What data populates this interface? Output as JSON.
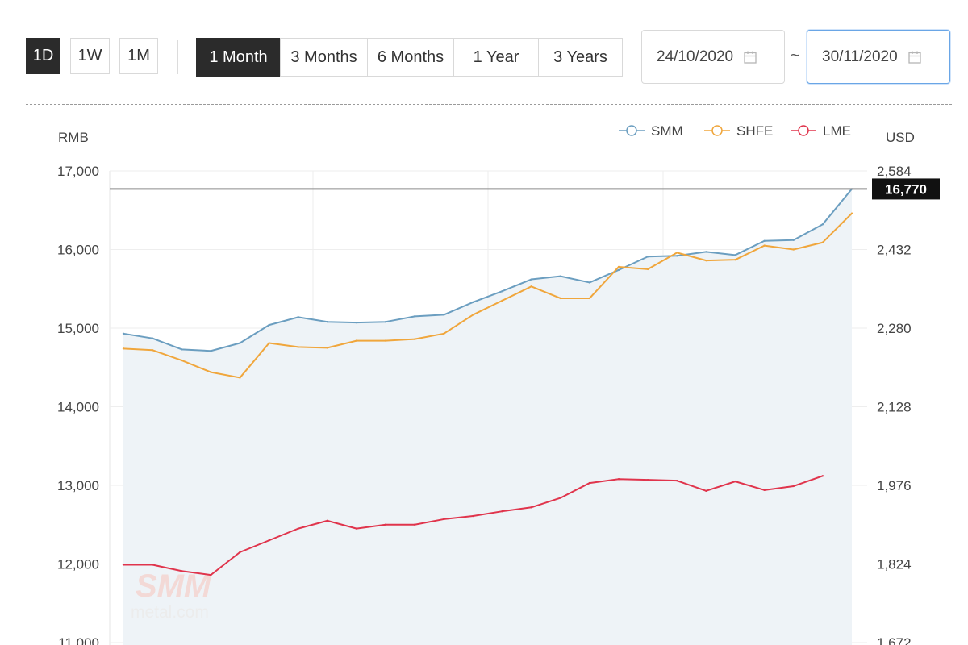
{
  "toolbar": {
    "interval_buttons": [
      {
        "label": "1D",
        "active": true
      },
      {
        "label": "1W",
        "active": false
      },
      {
        "label": "1M",
        "active": false
      }
    ],
    "range_tabs": [
      {
        "label": "1 Month",
        "active": true
      },
      {
        "label": "3 Months",
        "active": false
      },
      {
        "label": "6 Months",
        "active": false
      },
      {
        "label": "1 Year",
        "active": false
      },
      {
        "label": "3 Years",
        "active": false
      }
    ],
    "start_date": "24/10/2020",
    "end_date": "30/11/2020",
    "date_separator": "~"
  },
  "watermark": {
    "line1": "SMM",
    "line2": "metal.com"
  },
  "chart_data": {
    "type": "line",
    "left_axis_label": "RMB",
    "right_axis_label": "USD",
    "y_left_ticks": [
      11000,
      12000,
      13000,
      14000,
      15000,
      16000,
      17000
    ],
    "y_left_tick_labels": [
      "11,000",
      "12,000",
      "13,000",
      "14,000",
      "15,000",
      "16,000",
      "17,000"
    ],
    "y_right_tick_labels": [
      "1,672",
      "1,824",
      "1,976",
      "2,128",
      "2,280",
      "2,432",
      "2,584"
    ],
    "ylim": [
      11000,
      17000
    ],
    "legend": {
      "position": "top-right"
    },
    "highlight": {
      "value": 16770,
      "label": "16,770"
    },
    "series": [
      {
        "name": "SMM",
        "color": "#6b9ec0",
        "area": true,
        "values": [
          14930,
          14870,
          14730,
          14710,
          14810,
          15040,
          15140,
          15080,
          15070,
          15080,
          15150,
          15170,
          15330,
          15470,
          15620,
          15660,
          15580,
          15740,
          15910,
          15920,
          15970,
          15930,
          16110,
          16120,
          16320,
          16770
        ]
      },
      {
        "name": "SHFE",
        "color": "#f0a63c",
        "area": false,
        "values": [
          14740,
          14720,
          14590,
          14440,
          14370,
          14810,
          14760,
          14750,
          14840,
          14840,
          14860,
          14930,
          15170,
          15350,
          15530,
          15380,
          15380,
          15780,
          15750,
          15960,
          15860,
          15870,
          16050,
          16000,
          16090,
          16460
        ]
      },
      {
        "name": "LME",
        "color": "#e0344c",
        "area": false,
        "values": [
          11990,
          11990,
          11910,
          11860,
          12150,
          12300,
          12450,
          12550,
          12450,
          12500,
          12500,
          12570,
          12610,
          12670,
          12720,
          12840,
          13030,
          13080,
          13070,
          13060,
          12930,
          13050,
          12940,
          12990,
          13120
        ]
      }
    ]
  }
}
